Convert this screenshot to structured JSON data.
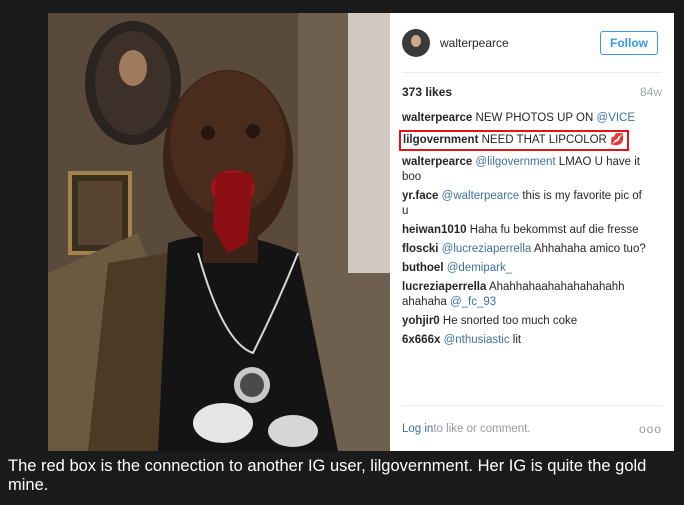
{
  "post": {
    "username": "walterpearce",
    "follow_label": "Follow",
    "likes": "373 likes",
    "age": "84w",
    "comments": [
      {
        "user": "walterpearce",
        "text": " NEW PHOTOS UP ON ",
        "mention": "@VICE",
        "after": ""
      },
      {
        "user": "lilgovernment",
        "text": " NEED THAT LIPCOLOR ",
        "mention": "",
        "after": "💋"
      },
      {
        "user": "walterpearce",
        "text": " ",
        "mention": "@lilgovernment",
        "after": " LMAO U have it boo"
      },
      {
        "user": "yr.face",
        "text": " ",
        "mention": "@walterpearce",
        "after": " this is my favorite pic of u"
      },
      {
        "user": "heiwan1010",
        "text": " Haha fu bekommst auf die fresse",
        "mention": "",
        "after": ""
      },
      {
        "user": "floscki",
        "text": " ",
        "mention": "@lucreziaperrella",
        "after": " Ahhahaha amico tuo?"
      },
      {
        "user": "buthoel",
        "text": " ",
        "mention": "@demipark_",
        "after": ""
      },
      {
        "user": "lucreziaperrella",
        "text": " Ahahhahaahahahahahahh ahahaha ",
        "mention": "@_fc_93",
        "after": ""
      },
      {
        "user": "yohjir0",
        "text": " He snorted too much coke",
        "mention": "",
        "after": ""
      },
      {
        "user": "6x666x",
        "text": " ",
        "mention": "@nthusiastic",
        "after": " lit"
      }
    ],
    "login_link": "Log in",
    "login_suffix": " to like or comment.",
    "more_dots": "ooo"
  },
  "caption": "The red box is the connection to another IG user, lilgovernment. Her IG is quite the gold mine.",
  "colors": {
    "follow_blue": "#3897f0",
    "mention_blue": "#3f729b",
    "highlight_red": "#e0141c"
  }
}
